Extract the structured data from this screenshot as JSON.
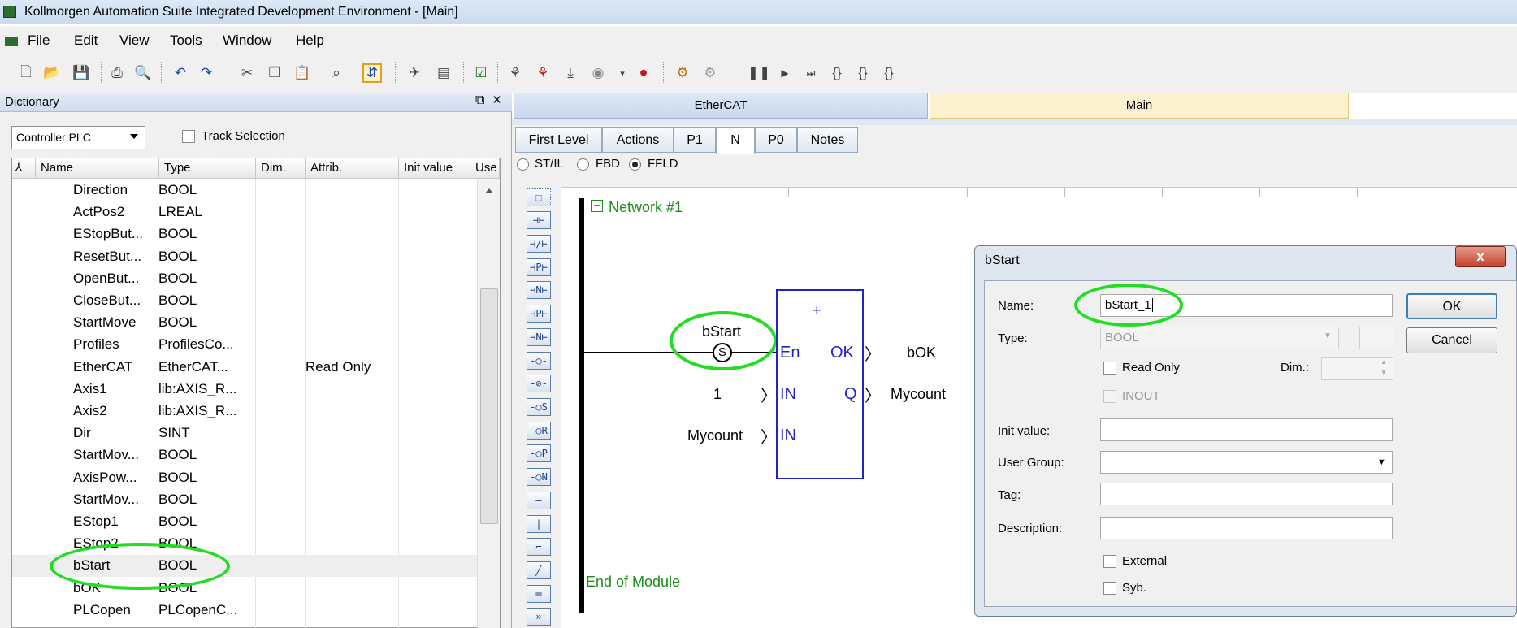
{
  "window": {
    "title": "Kollmorgen Automation Suite Integrated Development Environment - [Main]"
  },
  "menu": {
    "items": [
      "File",
      "Edit",
      "View",
      "Tools",
      "Window",
      "Help"
    ]
  },
  "dictionary": {
    "title": "Dictionary",
    "controller": "Controller:PLC",
    "track_selection_label": "Track Selection",
    "columns": [
      "Name",
      "Type",
      "Dim.",
      "Attrib.",
      "Init value",
      "Use"
    ],
    "rows": [
      {
        "name": "Direction",
        "type": "BOOL",
        "attrib": ""
      },
      {
        "name": "ActPos2",
        "type": "LREAL",
        "attrib": ""
      },
      {
        "name": "EStopBut...",
        "type": "BOOL",
        "attrib": ""
      },
      {
        "name": "ResetBut...",
        "type": "BOOL",
        "attrib": ""
      },
      {
        "name": "OpenBut...",
        "type": "BOOL",
        "attrib": ""
      },
      {
        "name": "CloseBut...",
        "type": "BOOL",
        "attrib": ""
      },
      {
        "name": "StartMove",
        "type": "BOOL",
        "attrib": ""
      },
      {
        "name": "Profiles",
        "type": "ProfilesCo...",
        "attrib": ""
      },
      {
        "name": "EtherCAT",
        "type": "EtherCAT...",
        "attrib": "Read Only"
      },
      {
        "name": "Axis1",
        "type": "lib:AXIS_R...",
        "attrib": ""
      },
      {
        "name": "Axis2",
        "type": "lib:AXIS_R...",
        "attrib": ""
      },
      {
        "name": "Dir",
        "type": "SINT",
        "attrib": ""
      },
      {
        "name": "StartMov...",
        "type": "BOOL",
        "attrib": ""
      },
      {
        "name": "AxisPow...",
        "type": "BOOL",
        "attrib": ""
      },
      {
        "name": "StartMov...",
        "type": "BOOL",
        "attrib": ""
      },
      {
        "name": "EStop1",
        "type": "BOOL",
        "attrib": ""
      },
      {
        "name": "EStop2",
        "type": "BOOL",
        "attrib": ""
      },
      {
        "name": "bStart",
        "type": "BOOL",
        "attrib": ""
      },
      {
        "name": "bOK",
        "type": "BOOL",
        "attrib": ""
      },
      {
        "name": "PLCopen",
        "type": "PLCopenC...",
        "attrib": ""
      }
    ]
  },
  "doc_tabs": [
    "EtherCAT",
    "Main"
  ],
  "editor": {
    "sub_tabs": [
      "First Level",
      "Actions",
      "P1",
      "N",
      "P0",
      "Notes"
    ],
    "languages": [
      "ST/IL",
      "FBD",
      "FFLD"
    ],
    "network_label": "Network #1",
    "end_label": "End of Module",
    "contact_var": "bStart",
    "contact_symbol": "S",
    "block": {
      "op": "+",
      "in_en": "En",
      "in_1": "IN",
      "in_2": "IN",
      "out_ok": "OK",
      "out_q": "Q",
      "const_in": "1",
      "var_in": "Mycount",
      "var_ok": "bOK",
      "var_q": "Mycount"
    }
  },
  "dialog": {
    "title": "bStart",
    "close_glyph": "x",
    "name_label": "Name:",
    "name_value": "bStart_1",
    "type_label": "Type:",
    "type_value": "BOOL",
    "read_only_label": "Read Only",
    "dim_label": "Dim.:",
    "inout_label": "INOUT",
    "init_value_label": "Init value:",
    "user_group_label": "User Group:",
    "tag_label": "Tag:",
    "description_label": "Description:",
    "external_label": "External",
    "syb_label": "Syb.",
    "ok_label": "OK",
    "cancel_label": "Cancel"
  }
}
